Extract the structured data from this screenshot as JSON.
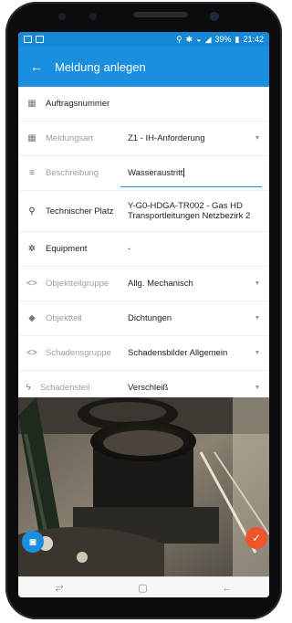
{
  "status_bar": {
    "icons": [
      "picture-icon",
      "notification-icon",
      "location-icon",
      "bluetooth-icon",
      "wifi-icon",
      "signal-icon",
      "battery-icon"
    ],
    "battery": "39%",
    "time": "21:42"
  },
  "appbar": {
    "title": "Meldung anlegen",
    "color": "#1a8fe0"
  },
  "form": {
    "fields": [
      {
        "label": "Auftragsnummer",
        "value": "",
        "icon": "grid-icon"
      },
      {
        "label": "Meldungsart",
        "value": "Z1 - IH-Anforderung",
        "icon": "grid-icon"
      },
      {
        "label": "Beschreibung",
        "value": "Wasseraustritt",
        "icon": "lines-icon"
      },
      {
        "label": "Technischer Platz",
        "value_line1": "Y-G0-HDGA-TR002 - Gas HD",
        "value_line2": "Transportleitungen Netzbezirk 2",
        "icon": "location-icon"
      },
      {
        "label": "Equipment",
        "value": "-",
        "icon": "gear-icon"
      },
      {
        "label": "Objektteilgruppe",
        "value": "Allg. Mechanisch",
        "icon": "code-icon"
      },
      {
        "label": "Objektteil",
        "value": "Dichtungen",
        "icon": "cube-icon"
      },
      {
        "label": "Schadensgruppe",
        "value": "Schadensbilder Allgemein",
        "icon": "code-icon"
      },
      {
        "label": "Schadensteil",
        "value": "Verschleiß",
        "icon": "bolt-icon"
      }
    ]
  },
  "photo": {
    "subject": "machine-part-photo"
  },
  "fabs": {
    "camera_color": "#1a8fe0",
    "confirm_color": "#f0542a"
  },
  "navbar": {
    "icons": [
      "recent-apps-icon",
      "home-icon",
      "back-icon"
    ]
  }
}
